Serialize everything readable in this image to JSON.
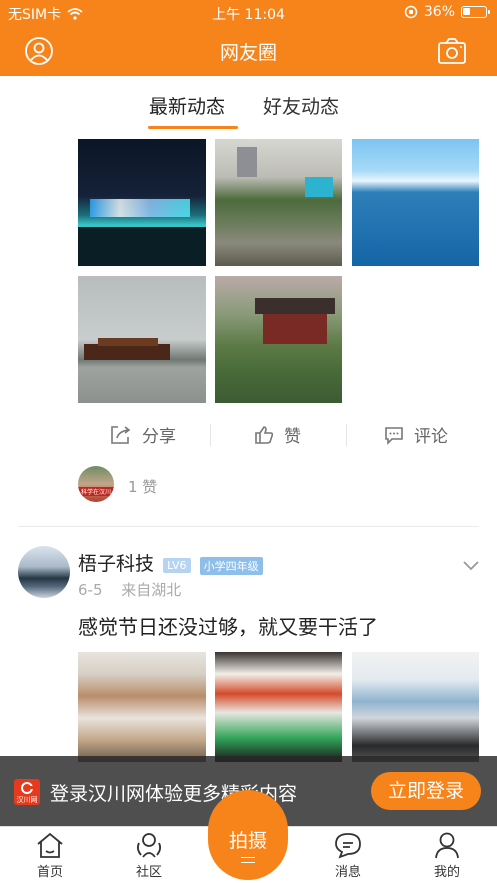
{
  "status_bar": {
    "carrier": "无SIM卡",
    "time": "上午 11:04",
    "battery": "36%",
    "battery_level": 0.36
  },
  "header": {
    "title": "网友圈"
  },
  "feed_tabs": [
    {
      "label": "最新动态",
      "active": true
    },
    {
      "label": "好友动态",
      "active": false
    }
  ],
  "actions": {
    "share": "分享",
    "like": "赞",
    "comment": "评论"
  },
  "likes": {
    "count_label": "1 赞",
    "avatar_caption": "科学在汉川"
  },
  "post": {
    "author": "梧子科技",
    "level": "LV6",
    "grade": "小学四年级",
    "date": "6-5",
    "location": "来自湖北",
    "text": "感觉节日还没过够，就又要干活了"
  },
  "banner": {
    "logo_text": "汉川网",
    "message": "登录汉川网体验更多精彩内容",
    "button": "立即登录"
  },
  "center_button": {
    "label": "拍摄"
  },
  "bottom_nav": [
    {
      "label": "首页",
      "icon": "home-icon"
    },
    {
      "label": "社区",
      "icon": "community-icon"
    },
    {
      "label": "消息",
      "icon": "message-icon"
    },
    {
      "label": "我的",
      "icon": "user-icon"
    }
  ],
  "colors": {
    "accent": "#f7841b",
    "badge_level": "#a9c9ef",
    "badge_grade": "#7db5e8"
  }
}
